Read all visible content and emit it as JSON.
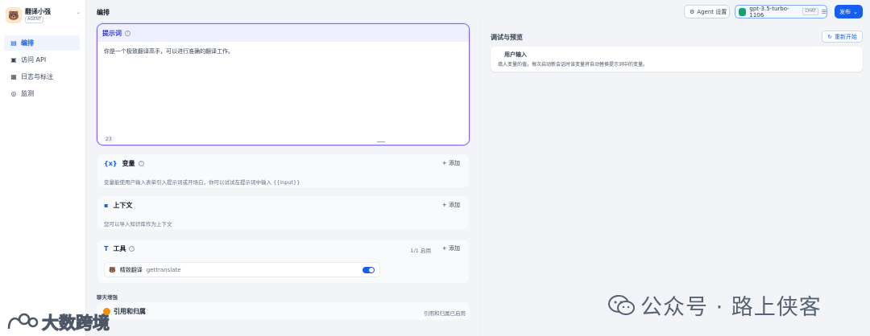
{
  "app": {
    "name": "翻译小强",
    "badge": "AGENT",
    "avatar_emoji": "🐻"
  },
  "sidebar": {
    "items": [
      {
        "label": "编排",
        "icon": "layout-icon",
        "active": true
      },
      {
        "label": "访问 API",
        "icon": "terminal-icon",
        "active": false
      },
      {
        "label": "日志与标注",
        "icon": "doc-icon",
        "active": false
      },
      {
        "label": "监测",
        "icon": "monitor-icon",
        "active": false
      }
    ]
  },
  "header": {
    "title": "编排",
    "agent_settings": "Agent 设置",
    "model": "gpt-3.5-turbo-1106",
    "model_tag": "CHAT",
    "publish": "发布"
  },
  "prompt": {
    "title": "提示词",
    "text": "你是一个极致翻译高手，可以进行准确的翻译工作。",
    "char_count": "23"
  },
  "variables": {
    "title": "变量",
    "icon": "{x}",
    "add": "+ 添加",
    "desc": "变量能使用户输入表单引入提示词或开场白，你可以试试在提示词中输入 {{input}}"
  },
  "context": {
    "title": "上下文",
    "add": "+ 添加",
    "desc": "您可以导入知识库作为上下文"
  },
  "tools": {
    "title": "工具",
    "count": "1/1 启用",
    "add": "+ 添加",
    "items": [
      {
        "name": "精致翻译",
        "id": "gettranslate",
        "enabled": true
      }
    ]
  },
  "chat_enhance": {
    "label": "聊天增强",
    "citation_title": "引用和归属",
    "citation_status": "引用和归属已启用"
  },
  "debug": {
    "title": "调试与预览",
    "restart": "重新开始",
    "user_input_label": "用户输入",
    "user_input_desc": "填入变量的值，每次启动新会话时该变量将自动替换提示词中的变量。"
  },
  "watermarks": {
    "right": "公众号 · 路上侠客",
    "left": "大数跨境"
  },
  "colors": {
    "accent": "#155eef",
    "prompt_border": "#7b61ff"
  }
}
